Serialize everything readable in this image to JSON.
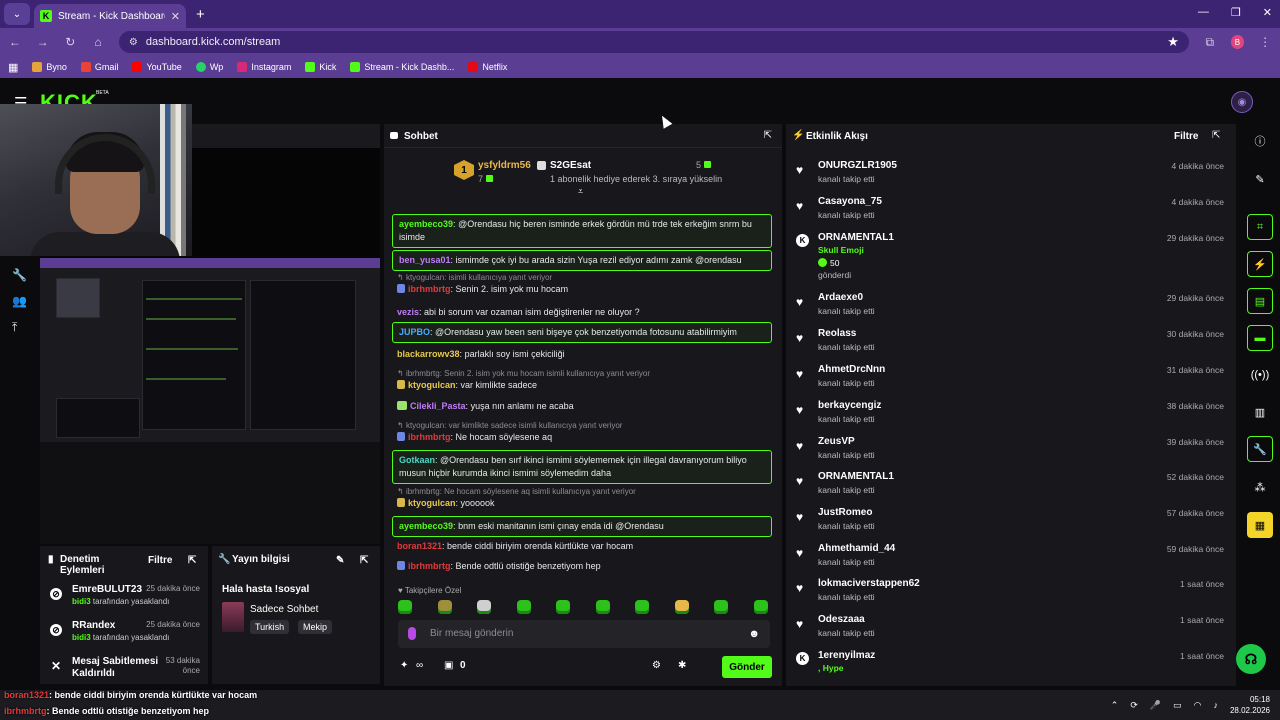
{
  "browser": {
    "tab_title": "Stream - Kick Dashboard",
    "url": "dashboard.kick.com/stream",
    "bookmarks": [
      "Byno",
      "Gmail",
      "YouTube",
      "Wp",
      "Instagram",
      "Kick",
      "Stream - Kick Dashb...",
      "Netflix"
    ]
  },
  "header": {
    "logo": "KICK",
    "beta": "BETA"
  },
  "chat": {
    "title": "Sohbet",
    "pinned": {
      "rank": "1",
      "top_gifter": "ysfyldrm56",
      "top_gifter_count": "7",
      "gifter2": "S2GEsat",
      "gifter2_count": "5",
      "gifter2_desc": "1 abonelik hediye ederek 3. sıraya yükselin"
    },
    "messages": [
      {
        "user": "ayembeco39",
        "text": "@Orendasu hiç beren isminde erkek gördün mü trde tek erkeğim snrm bu isimde"
      },
      {
        "user": "ben_yusa01",
        "text": "ismimde çok iyi bu arada sizin Yuşa rezil ediyor adımı zamk @orendasu"
      },
      {
        "reply": "ktyogulcan: isimli kullanıcıya yanıt veriyor",
        "user": "ibrhmbrtg",
        "text": "Senin 2. isim yok mu hocam"
      },
      {
        "user": "vezis",
        "text": "abi bi sorum var ozaman isim değiştirenler ne oluyor ?"
      },
      {
        "user": "JUPBO",
        "text": "@Orendasu yaw been seni bişeye çok benzetiyomda fotosunu atabilirmiyim"
      },
      {
        "user": "blackarrowv38",
        "text": "parlaklı soy ismi çekiciliği"
      },
      {
        "reply": "ibrhmbrtg: Senin 2. isim yok mu hocam isimli kullanıcıya yanıt veriyor",
        "user": "ktyogulcan",
        "text": "var kimlikte sadece"
      },
      {
        "user": "Cilekli_Pasta",
        "text": "yuşa nın anlamı ne acaba"
      },
      {
        "reply": "ktyogulcan: var kimlikte sadece isimli kullanıcıya yanıt veriyor",
        "user": "ibrhmbrtg",
        "text": "Ne hocam söylesene aq"
      },
      {
        "user": "Gotkaan",
        "text": "@Orendasu ben sırf ikinci ismimi söylememek için illegal davranıyorum biliyo musun hiçbir kurumda ikinci ismimi söylemedim daha"
      },
      {
        "reply": "ibrhmbrtg: Ne hocam söylesene aq isimli kullanıcıya yanıt veriyor",
        "user": "ktyogulcan",
        "text": "yoooook"
      },
      {
        "user": "ayembeco39",
        "text": "bnm eski manitanın ismi çınay enda idi @Orendasu"
      },
      {
        "user": "boran1321",
        "text": "bende ciddi biriyim orenda kürtlükte var hocam"
      },
      {
        "user": "ibrhmbrtg",
        "text": "Bende odtlü otistiğe benzetiyom hep"
      }
    ],
    "emote_section": "Takipçilere Özel",
    "input_placeholder": "Bir mesaj gönderin",
    "infinity": "∞",
    "points": "0",
    "send_label": "Gönder"
  },
  "feed": {
    "title": "Etkinlik Akışı",
    "filter_label": "Filtre",
    "follow_text": "kanalı takip etti",
    "events": [
      {
        "user": "ONURGZLR1905",
        "time": "4 dakika önce"
      },
      {
        "user": "Casayona_75",
        "time": "4 dakika önce"
      },
      {
        "user": "ORNAMENTAL1",
        "time": "29 dakika önce",
        "gift": "Skull Emoji",
        "amount": "50",
        "sent": "gönderdi"
      },
      {
        "user": "Ardaexe0",
        "time": "29 dakika önce"
      },
      {
        "user": "Reolass",
        "time": "30 dakika önce"
      },
      {
        "user": "AhmetDrcNnn",
        "time": "31 dakika önce"
      },
      {
        "user": "berkaycengiz",
        "time": "38 dakika önce"
      },
      {
        "user": "ZeusVP",
        "time": "39 dakika önce"
      },
      {
        "user": "ORNAMENTAL1",
        "time": "52 dakika önce"
      },
      {
        "user": "JustRomeo",
        "time": "57 dakika önce"
      },
      {
        "user": "Ahmethamid_44",
        "time": "59 dakika önce"
      },
      {
        "user": "lokmaciverstappen62",
        "time": "1 saat önce"
      },
      {
        "user": "Odeszaaa",
        "time": "1 saat önce"
      },
      {
        "user": "1erenyilmaz",
        "time": "1 saat önce",
        "gift": ", Hype"
      }
    ]
  },
  "moderation": {
    "title_line1": "Denetim",
    "title_line2": "Eylemleri",
    "filter_label": "Filtre",
    "items": [
      {
        "name": "EmreBULUT23",
        "time": "25 dakika önce",
        "by_user": "bidi3",
        "by_text": "tarafından yasaklandı"
      },
      {
        "name": "RRandex",
        "time": "25 dakika önce",
        "by_user": "bidi3",
        "by_text": "tarafından yasaklandı"
      },
      {
        "name": "Mesaj Sabitlemesi Kaldırıldı",
        "time": "53 dakika önce"
      }
    ]
  },
  "stream_info": {
    "title": "Yayın bilgisi",
    "stream_title": "Hala hasta !sosyal",
    "category": "Sadece Sohbet",
    "tags": [
      "Turkish",
      "Mekip"
    ]
  },
  "overlay": [
    {
      "user": "boran1321",
      "text": ": bende ciddi biriyim orenda kürtlükte var hocam"
    },
    {
      "user": "ibrhmbrtg",
      "text": ": Bende odtlü otistiğe benzetiyom hep"
    }
  ],
  "taskbar": {
    "time": "05:18",
    "date": "28.02.2026"
  }
}
